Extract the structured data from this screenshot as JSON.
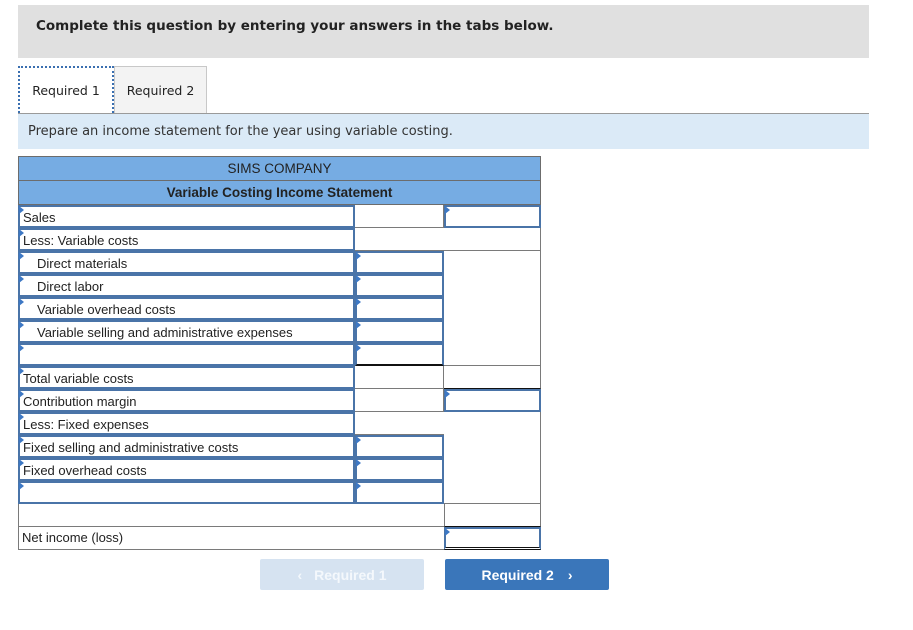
{
  "banner": {
    "text": "Complete this question by entering your answers in the tabs below."
  },
  "tabs": [
    {
      "label": "Required 1",
      "active": true
    },
    {
      "label": "Required 2",
      "active": false
    }
  ],
  "instruction": "Prepare an income statement for the year using variable costing.",
  "statement": {
    "company": "SIMS COMPANY",
    "title": "Variable Costing Income Statement",
    "rows": [
      {
        "label": "Sales",
        "col2": "",
        "col3": ""
      },
      {
        "label": "Less: Variable costs",
        "col2": "",
        "col3": ""
      },
      {
        "label": "Direct materials",
        "col2": "",
        "col3": ""
      },
      {
        "label": "Direct labor",
        "col2": "",
        "col3": ""
      },
      {
        "label": "Variable overhead costs",
        "col2": "",
        "col3": ""
      },
      {
        "label": "Variable selling and administrative expenses",
        "col2": "",
        "col3": ""
      },
      {
        "label": "",
        "col2": "",
        "col3": ""
      },
      {
        "label": "Total variable costs",
        "col2": "",
        "col3": ""
      },
      {
        "label": "Contribution margin",
        "col2": "",
        "col3": ""
      },
      {
        "label": "Less: Fixed expenses",
        "col2": "",
        "col3": ""
      },
      {
        "label": "Fixed selling and administrative costs",
        "col2": "",
        "col3": ""
      },
      {
        "label": "Fixed overhead costs",
        "col2": "",
        "col3": ""
      },
      {
        "label": "",
        "col2": "",
        "col3": ""
      },
      {
        "label": "",
        "col2": "",
        "col3": ""
      },
      {
        "label": "Net income (loss)",
        "col2": "",
        "col3": ""
      }
    ]
  },
  "nav": {
    "prev_label": "Required 1",
    "next_label": "Required 2",
    "prev_icon": "chevron-left-icon",
    "next_icon": "chevron-right-icon"
  },
  "colors": {
    "header_blue": "#76ace3",
    "button_blue": "#3a76ba",
    "button_disabled": "#d6e3f1",
    "info_bg": "#dbeaf7",
    "banner_bg": "#e0e0e0"
  }
}
